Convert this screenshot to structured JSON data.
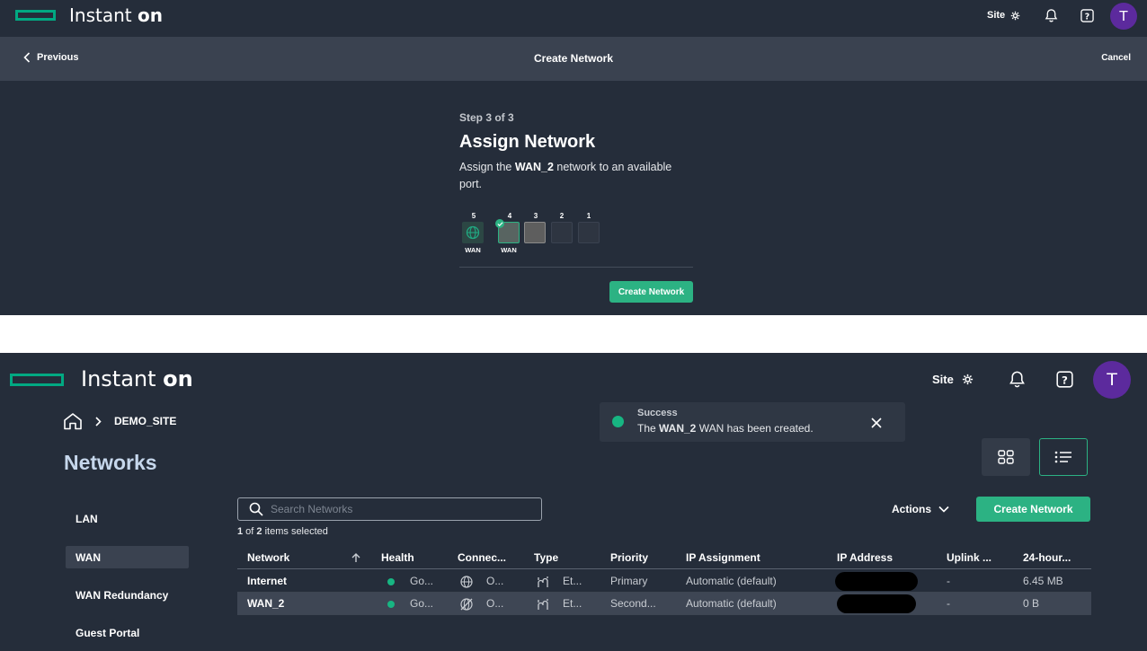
{
  "app": {
    "brand_prefix": "Instant",
    "brand_suffix": "on",
    "site_label": "Site",
    "avatar_initial": "T"
  },
  "wizard": {
    "previous_label": "Previous",
    "title": "Create Network",
    "cancel_label": "Cancel",
    "step_label": "Step 3 of 3",
    "heading": "Assign Network",
    "desc_pre": "Assign the ",
    "desc_network": "WAN_2",
    "desc_post": " network to an available port.",
    "ports": [
      {
        "number": "5",
        "label": "WAN",
        "state": "wan-internet"
      },
      {
        "number": "4",
        "label": "WAN",
        "state": "selected"
      },
      {
        "number": "3",
        "label": "",
        "state": "available"
      },
      {
        "number": "2",
        "label": "",
        "state": "empty"
      },
      {
        "number": "1",
        "label": "",
        "state": "empty"
      }
    ],
    "create_button": "Create Network"
  },
  "networks_page": {
    "breadcrumb_site": "DEMO_SITE",
    "title": "Networks",
    "nav": [
      "LAN",
      "WAN",
      "WAN Redundancy",
      "Guest Portal"
    ],
    "nav_selected": "WAN",
    "toast": {
      "title": "Success",
      "msg_pre": "The ",
      "msg_network": "WAN_2",
      "msg_post": " WAN has been created."
    },
    "search_placeholder": "Search Networks",
    "selection": {
      "selected": "1",
      "middle": " of ",
      "total": "2",
      "suffix": " items selected"
    },
    "actions_label": "Actions",
    "create_button": "Create Network",
    "columns": [
      "Network",
      "Health",
      "Connec...",
      "Type",
      "Priority",
      "IP Assignment",
      "IP Address",
      "Uplink ...",
      "24-hour..."
    ],
    "rows": [
      {
        "network": "Internet",
        "health": "Go...",
        "connection": "O...",
        "type": "Et...",
        "priority": "Primary",
        "ip_assignment": "Automatic (default)",
        "uplink": "-",
        "usage": "6.45 MB"
      },
      {
        "network": "WAN_2",
        "health": "Go...",
        "connection": "O...",
        "type": "Et...",
        "priority": "Second...",
        "ip_assignment": "Automatic (default)",
        "uplink": "-",
        "usage": "0 B"
      }
    ]
  },
  "colors": {
    "accent": "#2cb283",
    "background": "#252d3a",
    "avatar": "#5c2a9d",
    "status_good": "#17b582"
  }
}
